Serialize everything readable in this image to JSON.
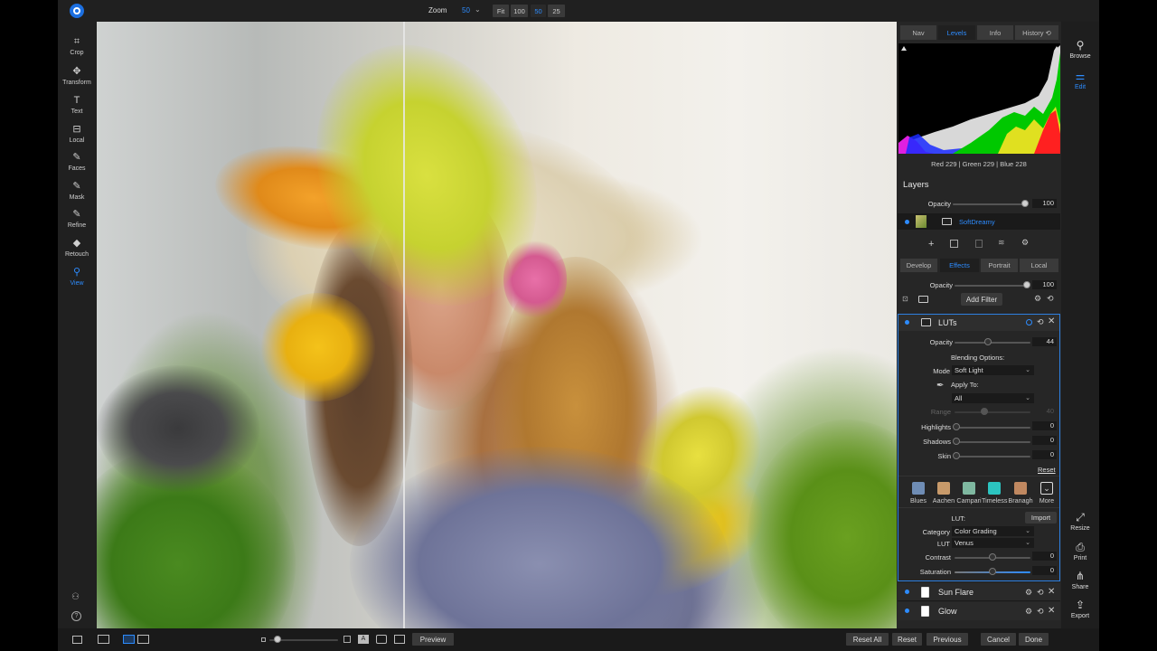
{
  "topbar": {
    "zoom_label": "Zoom",
    "zoom_value": "50",
    "zoom_chevron": "⌄",
    "zoom_presets": [
      "Fit",
      "100",
      "50",
      "25"
    ],
    "zoom_selected": "50"
  },
  "tools": [
    {
      "label": "Crop",
      "icon": "crop-icon",
      "glyph": "⌗"
    },
    {
      "label": "Transform",
      "icon": "transform-icon",
      "glyph": "✥"
    },
    {
      "label": "Text",
      "icon": "text-icon",
      "glyph": "T"
    },
    {
      "label": "Local",
      "icon": "local-icon",
      "glyph": "⊟"
    },
    {
      "label": "Faces",
      "icon": "faces-icon",
      "glyph": "✎"
    },
    {
      "label": "Mask",
      "icon": "mask-icon",
      "glyph": "✎"
    },
    {
      "label": "Refine",
      "icon": "refine-icon",
      "glyph": "✎"
    },
    {
      "label": "Retouch",
      "icon": "retouch-icon",
      "glyph": "◆"
    },
    {
      "label": "View",
      "icon": "view-icon",
      "glyph": "⚲",
      "active": true
    }
  ],
  "panel": {
    "tabs": [
      "Nav",
      "Levels",
      "Info",
      "History ⟲"
    ],
    "selected_tab": "Levels",
    "rgb_readout": "Red 229 | Green 229 | Blue 228",
    "layers_title": "Layers",
    "layers_opacity_label": "Opacity",
    "layers_opacity_value": "100",
    "layers_opacity_fraction": 1.0,
    "layer_name": "SoftDreamy",
    "sub_tabs": [
      "Develop",
      "Effects",
      "Portrait",
      "Local"
    ],
    "sub_selected": "Effects",
    "effects_opacity_label": "Opacity",
    "effects_opacity_value": "100",
    "effects_opacity_fraction": 1.0,
    "add_filter": "Add Filter",
    "luts": {
      "title": "LUTs",
      "opacity_label": "Opacity",
      "opacity_value": "44",
      "opacity_fraction": 0.44,
      "blending_title": "Blending Options:",
      "mode_label": "Mode",
      "mode_value": "Soft Light",
      "apply_to_label": "Apply To:",
      "apply_to_value": "All",
      "range_label": "Range",
      "range_value": "40",
      "highlights_label": "Highlights",
      "highlights_value": "0",
      "shadows_label": "Shadows",
      "shadows_value": "0",
      "skin_label": "Skin",
      "skin_value": "0",
      "reset_label": "Reset",
      "presets": [
        {
          "label": "Blues",
          "color": "#6f8db5"
        },
        {
          "label": "Aachen",
          "color": "#c89a6a"
        },
        {
          "label": "Campari",
          "color": "#7fb8a0"
        },
        {
          "label": "Timeless",
          "color": "#2cc4c0"
        },
        {
          "label": "Branagh",
          "color": "#c08860"
        }
      ],
      "more_label": "More",
      "lut_label": "LUT:",
      "import_label": "Import",
      "category_label": "Category",
      "category_value": "Color Grading",
      "lut_select_label": "LUT",
      "lut_select_value": "Venus",
      "contrast_label": "Contrast",
      "contrast_value": "0",
      "saturation_label": "Saturation",
      "saturation_value": "0"
    },
    "sun_flare_title": "Sun Flare",
    "glow_title": "Glow"
  },
  "right_tools": [
    {
      "label": "Browse",
      "icon": "browse-icon",
      "glyph": "⚲"
    },
    {
      "label": "Edit",
      "icon": "edit-icon",
      "glyph": "⚌",
      "active": true
    },
    {
      "label": "Resize",
      "icon": "resize-icon",
      "glyph": "⤢"
    },
    {
      "label": "Print",
      "icon": "print-icon",
      "glyph": "⎙"
    },
    {
      "label": "Share",
      "icon": "share-icon",
      "glyph": "⋔"
    },
    {
      "label": "Export",
      "icon": "export-icon",
      "glyph": "⇪"
    }
  ],
  "bottom": {
    "preview_label": "Preview",
    "reset_all": "Reset All",
    "reset": "Reset",
    "previous": "Previous",
    "cancel": "Cancel",
    "done": "Done"
  },
  "colors": {
    "accent": "#2d8cff",
    "panel_bg": "#262626",
    "button_bg": "#3a3a3a"
  }
}
